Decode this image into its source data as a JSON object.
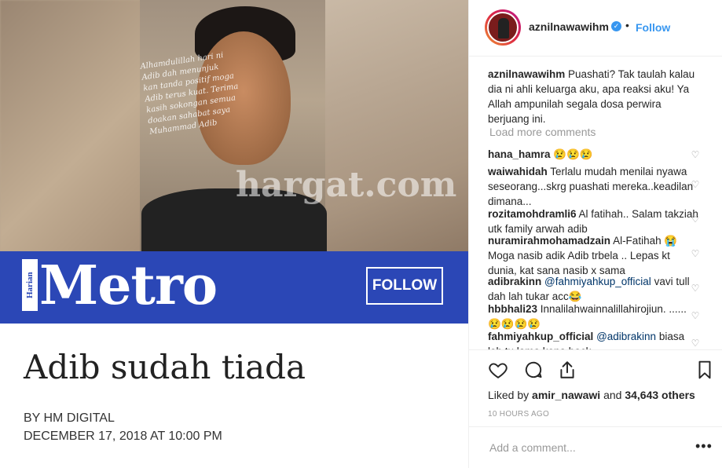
{
  "post_image": {
    "overlay_caption": "Alhamdulillah hari ni Adib dah menunjuk kan tanda positif moga Adib terus kuat. Terima kasih sokongan semua doakan sahabat saya Muhammad Adib",
    "watermark": "hargat.com",
    "banner_tag": "Harian",
    "banner_brand": "Metro",
    "banner_follow": "FOLLOW",
    "headline": "Adib sudah tiada",
    "byline": "BY HM DIGITAL",
    "dateline": "DECEMBER 17, 2018 AT 10:00 PM"
  },
  "header": {
    "username": "aznilnawawihm",
    "verified_icon": "verified-badge-icon",
    "separator": "•",
    "follow_label": "Follow"
  },
  "caption": {
    "user": "aznilnawawihm",
    "text": "Puashati? Tak taulah kalau dia ni ahli keluarga aku, apa reaksi aku! Ya Allah ampunilah segala dosa perwira berjuang ini."
  },
  "load_more": "Load more comments",
  "comments": [
    {
      "user": "hana_hamra",
      "text": "😢😢😢"
    },
    {
      "user": "waiwahidah",
      "text": "Terlalu mudah menilai nyawa seseorang...skrg puashati mereka..keadilan dimana..."
    },
    {
      "user": "rozitamohdramli6",
      "text": "Al fatihah.. Salam takziah utk family arwah adib"
    },
    {
      "user": "nuramirahmohamadzain",
      "text": "Al-Fatihah 😭 Moga nasib adik Adib trbela .. Lepas kt dunia, kat sana nasib x sama"
    },
    {
      "user": "adibrakinn",
      "mention": "@fahmiyahkup_official",
      "text": "vavi tull dah lah tukar acc😂"
    },
    {
      "user": "hbbhali23",
      "text": "Innalilahwainnalillahirojiun. ...... 😢😢😢😢"
    },
    {
      "user": "fahmiyahkup_official",
      "mention": "@adibrakinn",
      "text": "biasa lah tu lama kena back"
    }
  ],
  "actions": {
    "like_icon": "heart-icon",
    "comment_icon": "comment-icon",
    "share_icon": "share-icon",
    "save_icon": "bookmark-icon"
  },
  "likes": {
    "prefix": "Liked by",
    "user": "amir_nawawi",
    "conj": "and",
    "others": "34,643 others"
  },
  "timestamp": "10 HOURS AGO",
  "add_comment_placeholder": "Add a comment...",
  "more_options": "•••"
}
